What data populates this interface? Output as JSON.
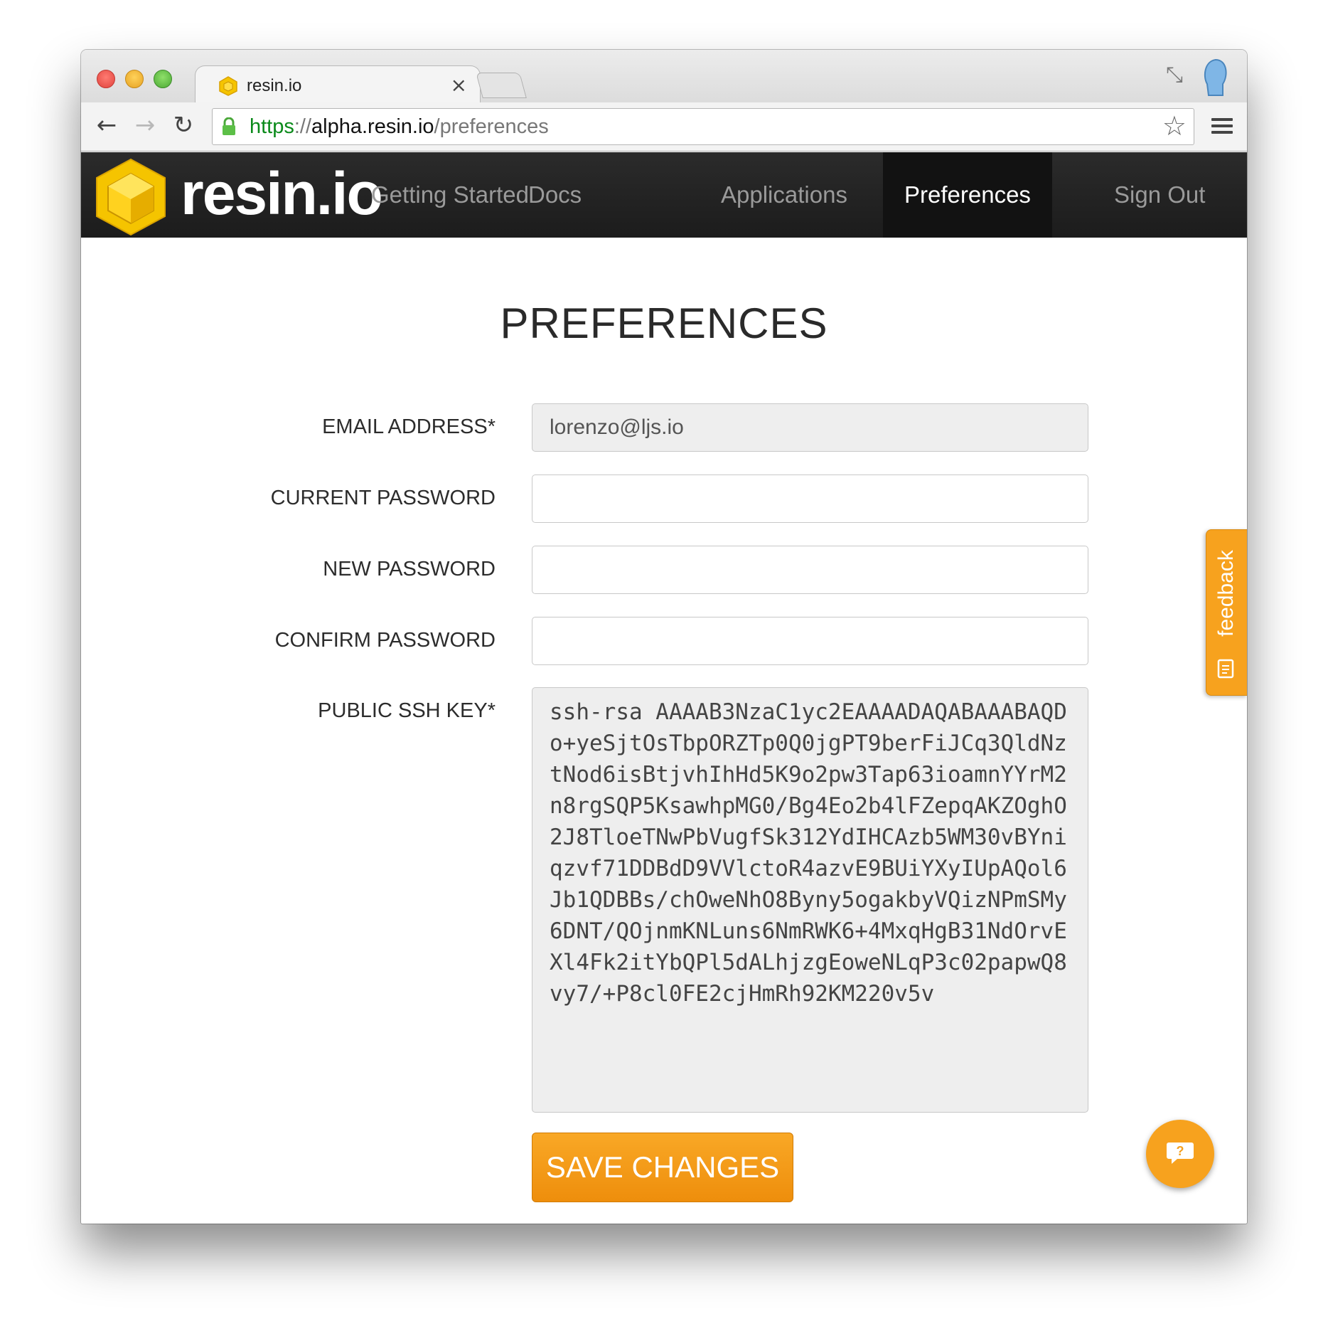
{
  "browser": {
    "tab_title": "resin.io",
    "url_scheme": "https",
    "url_separator": "://",
    "url_host": "alpha.resin.io",
    "url_path": "/preferences",
    "accent_secure": "#0a8a1a"
  },
  "navbar": {
    "brand": "resin.io",
    "links": [
      "Getting Started",
      "Docs",
      "Applications",
      "Preferences",
      "Sign Out"
    ],
    "active_link": "Preferences",
    "brand_color": "#f5c400"
  },
  "page": {
    "title": "PREFERENCES"
  },
  "form": {
    "email_label": "EMAIL ADDRESS*",
    "email_value": "lorenzo@ljs.io",
    "current_password_label": "CURRENT PASSWORD",
    "new_password_label": "NEW PASSWORD",
    "confirm_password_label": "CONFIRM PASSWORD",
    "ssh_key_label": "PUBLIC SSH KEY*",
    "ssh_key_value": "ssh-rsa AAAAB3NzaC1yc2EAAAADAQABAAABAQDo+yeSjtOsTbpORZTp0Q0jgPT9berFiJCq3QldNztNod6isBtjvhIhHd5K9o2pw3Tap63ioamnYYrM2n8rgSQP5KsawhpMG0/Bg4Eo2b4lFZepqAKZOghO2J8TloeTNwPbVugfSk312YdIHCAzb5WM30vBYniqzvf71DDBdD9VVlctoR4azvE9BUiYXyIUpAQol6Jb1QDBBs/chOweNhO8Byny5ogakbyVQizNPmSMy6DNT/QOjnmKNLuns6NmRWK6+4MxqHgB31NdOrvEXl4Fk2itYbQPl5dALhjzgEoweNLqP3c02papwQ8vy7/+P8cl0FE2cjHmRh92KM220v5v",
    "save_label": "SAVE CHANGES",
    "button_color": "#f5a01e"
  },
  "widgets": {
    "feedback_label": "feedback",
    "help_label": "?"
  }
}
